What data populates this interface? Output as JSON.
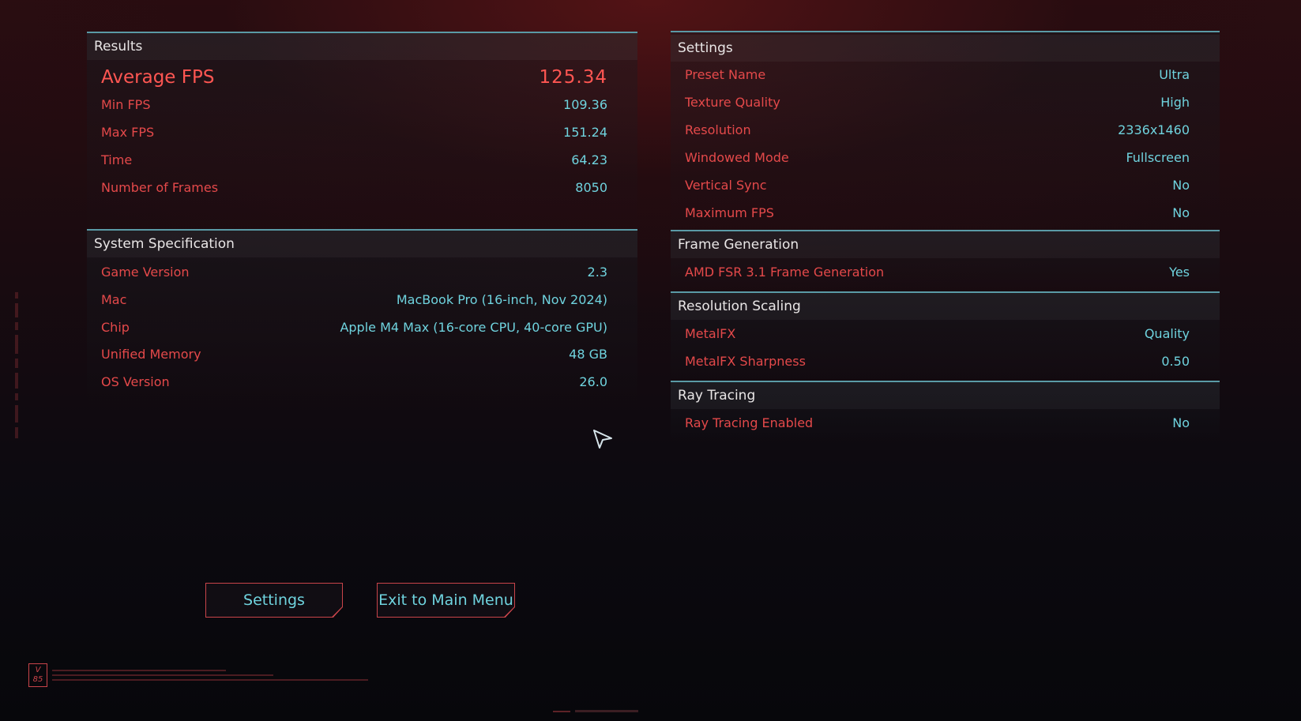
{
  "results": {
    "title": "Results",
    "average_fps": {
      "label": "Average FPS",
      "value": "125.34"
    },
    "rows": [
      {
        "label": "Min FPS",
        "value": "109.36"
      },
      {
        "label": "Max FPS",
        "value": "151.24"
      },
      {
        "label": "Time",
        "value": "64.23"
      },
      {
        "label": "Number of Frames",
        "value": "8050"
      }
    ]
  },
  "system": {
    "title": "System Specification",
    "rows": [
      {
        "label": "Game Version",
        "value": "2.3"
      },
      {
        "label": "Mac",
        "value": "MacBook Pro (16-inch, Nov 2024)"
      },
      {
        "label": "Chip",
        "value": "Apple M4 Max (16-core CPU, 40-core GPU)"
      },
      {
        "label": "Unified Memory",
        "value": "48 GB"
      },
      {
        "label": "OS Version",
        "value": "26.0"
      }
    ]
  },
  "settings": {
    "title": "Settings",
    "rows": [
      {
        "label": "Preset Name",
        "value": "Ultra"
      },
      {
        "label": "Texture Quality",
        "value": "High"
      },
      {
        "label": "Resolution",
        "value": "2336x1460"
      },
      {
        "label": "Windowed Mode",
        "value": "Fullscreen"
      },
      {
        "label": "Vertical Sync",
        "value": "No"
      },
      {
        "label": "Maximum FPS",
        "value": "No"
      }
    ]
  },
  "frame_generation": {
    "title": "Frame Generation",
    "rows": [
      {
        "label": "AMD FSR 3.1 Frame Generation",
        "value": "Yes"
      }
    ]
  },
  "resolution_scaling": {
    "title": "Resolution Scaling",
    "rows": [
      {
        "label": "MetalFX",
        "value": "Quality"
      },
      {
        "label": "MetalFX Sharpness",
        "value": "0.50"
      }
    ]
  },
  "ray_tracing": {
    "title": "Ray Tracing",
    "rows": [
      {
        "label": "Ray Tracing Enabled",
        "value": "No"
      }
    ]
  },
  "buttons": {
    "settings": "Settings",
    "exit": "Exit to Main Menu"
  },
  "branding": {
    "logo_text": "V 85"
  },
  "colors": {
    "label_red": "#e4494a",
    "value_cyan": "#6fd3de",
    "divider_teal": "#5a9aa6",
    "accent_red": "#ff5652"
  },
  "icons": {
    "cursor": "arrow-cursor-icon"
  }
}
